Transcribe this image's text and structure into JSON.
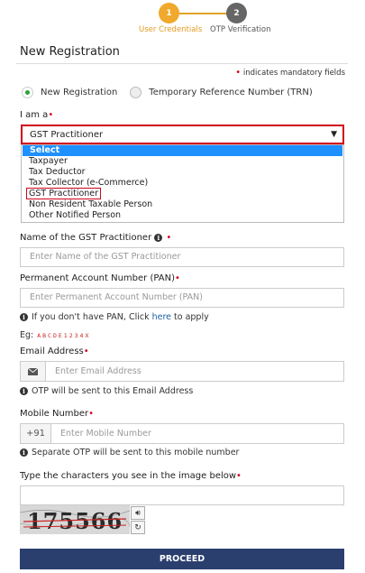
{
  "stepper": {
    "step1": {
      "number": "1",
      "label": "User Credentials"
    },
    "step2": {
      "number": "2",
      "label": "OTP Verification"
    }
  },
  "page": {
    "title": "New Registration",
    "mandatory_note": "indicates mandatory fields"
  },
  "registration_type": {
    "options": [
      "New Registration",
      "Temporary Reference Number (TRN)"
    ],
    "selected": "New Registration"
  },
  "i_am_a": {
    "label": "I am a",
    "selected": "GST Practitioner",
    "options": [
      "Select",
      "Taxpayer",
      "Tax Deductor",
      "Tax Collector (e-Commerce)",
      "GST Practitioner",
      "Non Resident Taxable Person",
      "Other Notified Person"
    ]
  },
  "name_field": {
    "label": "Name of the GST Practitioner",
    "placeholder": "Enter Name of the GST Practitioner"
  },
  "pan_field": {
    "label": "Permanent Account Number (PAN)",
    "placeholder": "Enter Permanent Account Number (PAN)",
    "help_prefix": "If you don't have PAN, Click",
    "help_link": "here",
    "help_suffix": "to apply",
    "eg_label": "Eg:",
    "eg_value": "ABCDE1234X"
  },
  "email_field": {
    "label": "Email Address",
    "placeholder": "Enter Email Address",
    "help": "OTP will be sent to this Email Address"
  },
  "mobile_field": {
    "label": "Mobile Number",
    "prefix": "+91",
    "placeholder": "Enter Mobile Number",
    "help": "Separate OTP will be sent to this mobile number"
  },
  "captcha": {
    "label": "Type the characters you see in the image below",
    "image_text": "175566"
  },
  "proceed_label": "PROCEED",
  "colors": {
    "accent": "#f0a92d",
    "required": "#d0021b",
    "primary_button": "#2b3f6f",
    "selected_option": "#1e90ff"
  }
}
